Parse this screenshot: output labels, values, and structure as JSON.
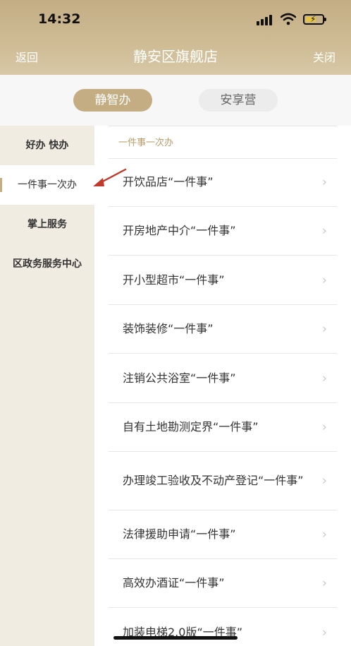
{
  "status_bar": {
    "time": "14:32"
  },
  "navbar": {
    "back": "返回",
    "title": "静安区旗舰店",
    "close": "关闭"
  },
  "tabs": [
    {
      "label": "静智办",
      "active": true
    },
    {
      "label": "安享营",
      "active": false
    }
  ],
  "sidebar": {
    "items": [
      {
        "label": "好办 快办",
        "active": false
      },
      {
        "label": "一件事一次办",
        "active": true
      },
      {
        "label": "掌上服务",
        "active": false
      },
      {
        "label": "区政务服务中心",
        "active": false
      }
    ]
  },
  "content": {
    "section_title": "一件事一次办",
    "items": [
      "开饮品店“一件事”",
      "开房地产中介“一件事”",
      "开小型超市“一件事”",
      "装饰装修“一件事”",
      "注销公共浴室“一件事”",
      "自有土地勘测定界“一件事”",
      "办理竣工验收及不动产登记“一件事”",
      "法律援助申请“一件事”",
      "高效办酒证“一件事”",
      "加装电梯2.0版“一件事”"
    ]
  },
  "colors": {
    "accent": "#c4ad82",
    "annotation": "#c0392b"
  }
}
